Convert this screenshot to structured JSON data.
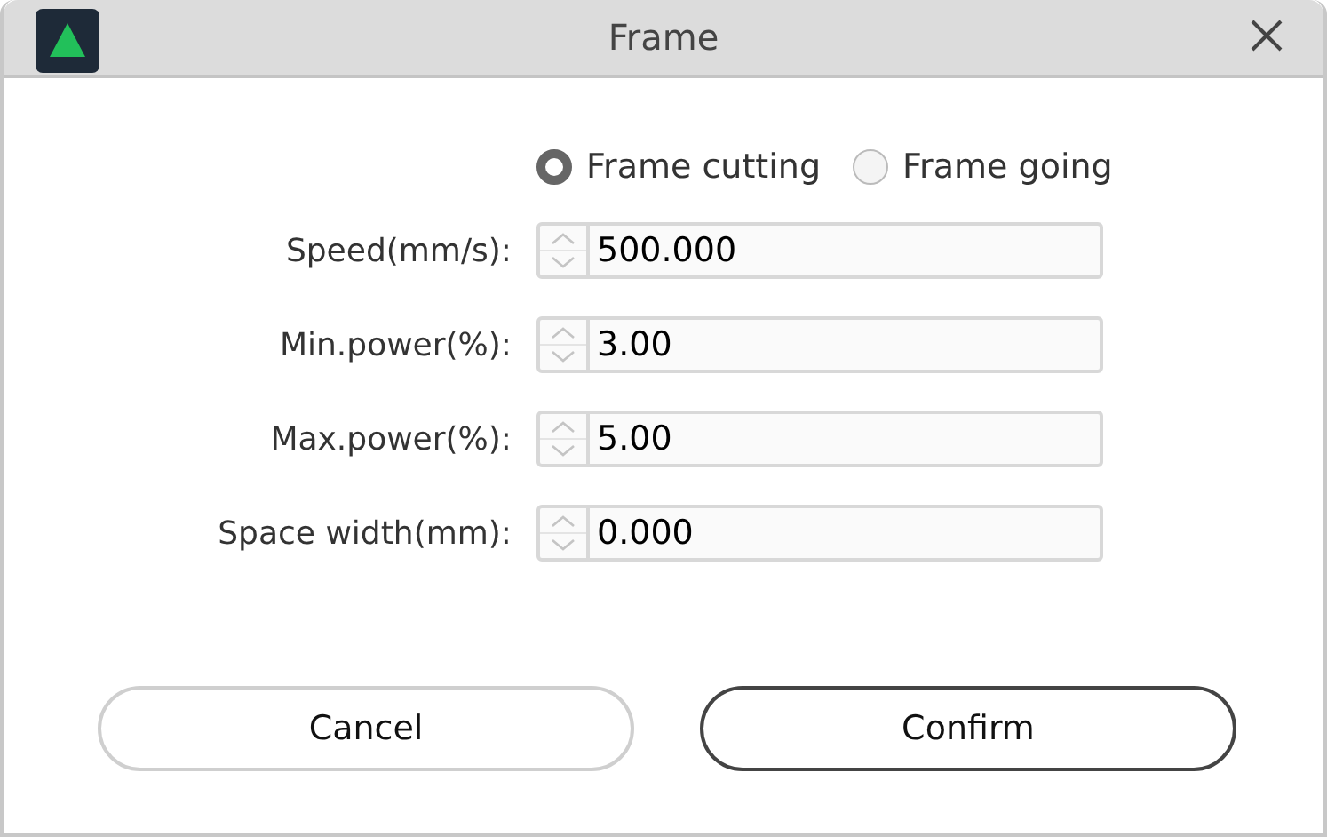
{
  "window": {
    "title": "Frame"
  },
  "mode_options": [
    {
      "label": "Frame cutting",
      "selected": true
    },
    {
      "label": "Frame going",
      "selected": false
    }
  ],
  "fields": [
    {
      "label": "Speed(mm/s):",
      "value": "500.000"
    },
    {
      "label": "Min.power(%):",
      "value": "3.00"
    },
    {
      "label": "Max.power(%):",
      "value": "5.00"
    },
    {
      "label": "Space width(mm):",
      "value": "0.000"
    }
  ],
  "buttons": [
    {
      "label": "Cancel",
      "kind": "secondary"
    },
    {
      "label": "Confirm",
      "kind": "primary"
    }
  ]
}
